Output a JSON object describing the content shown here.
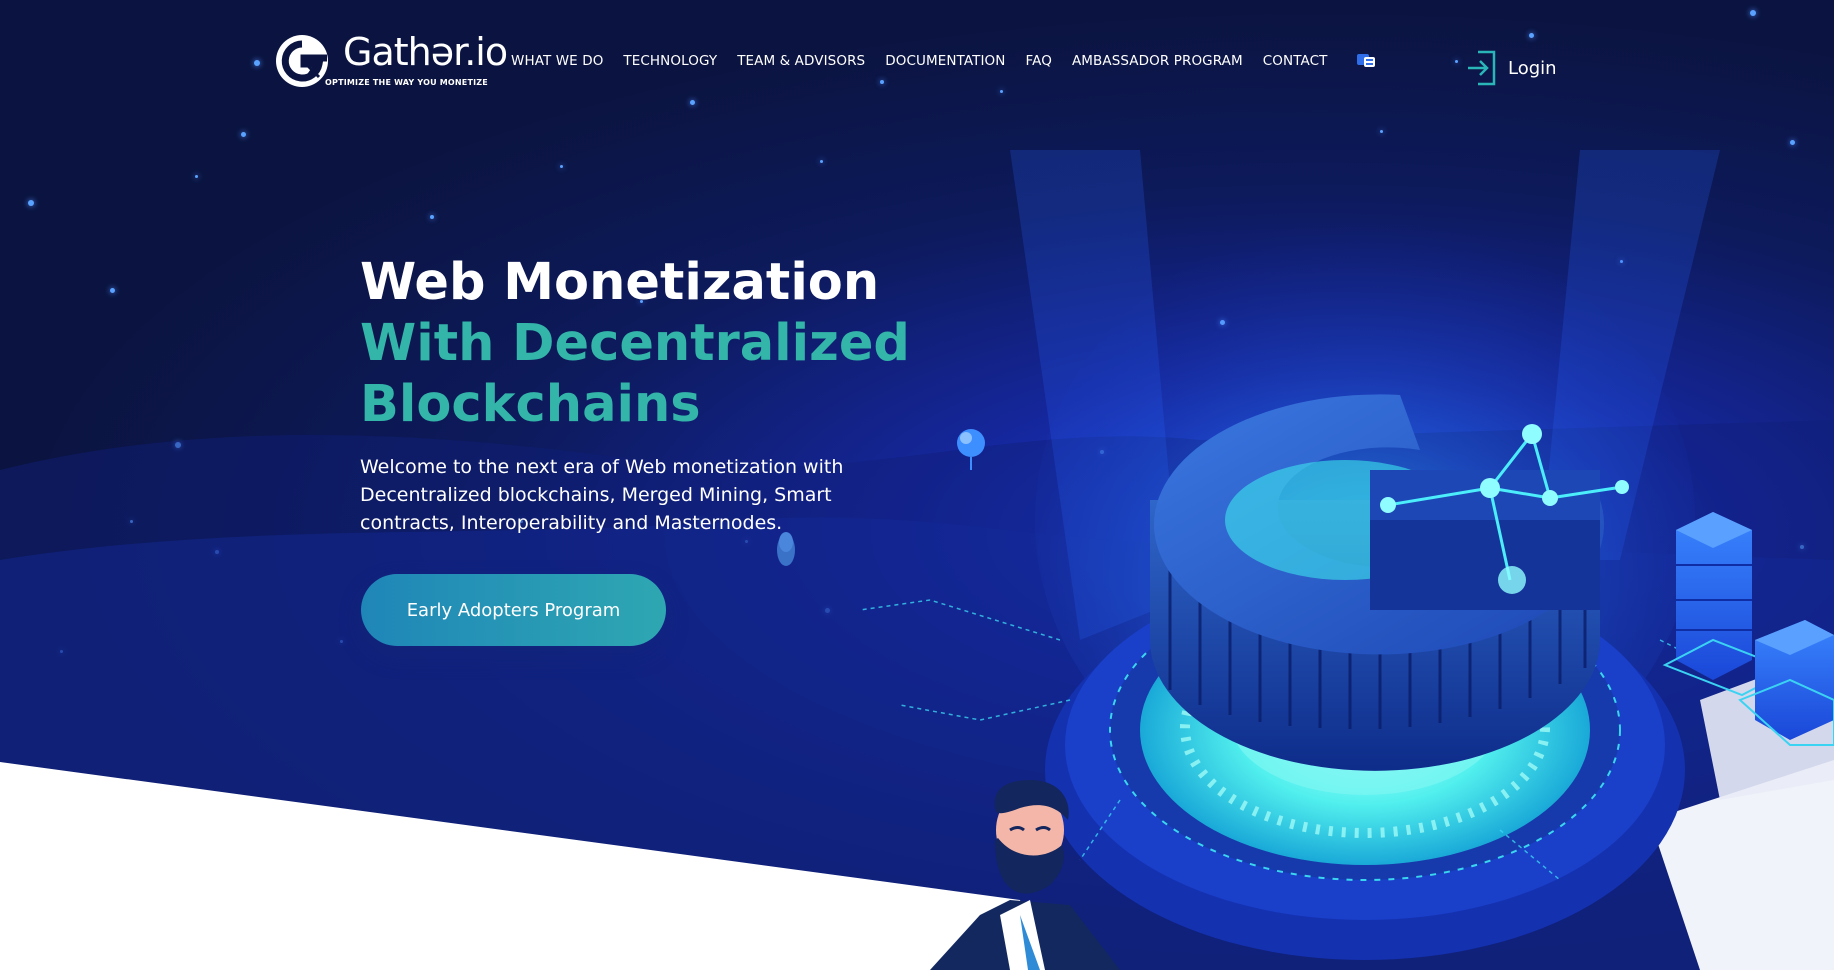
{
  "brand": {
    "name": "Gathər.io",
    "tagline": "OPTIMIZE THE WAY YOU MONETIZE"
  },
  "nav": {
    "items": [
      {
        "label": "WHAT WE DO"
      },
      {
        "label": "TECHNOLOGY"
      },
      {
        "label": "TEAM & ADVISORS"
      },
      {
        "label": "DOCUMENTATION"
      },
      {
        "label": "FAQ"
      },
      {
        "label": "AMBASSADOR PROGRAM"
      },
      {
        "label": "CONTACT"
      }
    ],
    "login_label": "Login"
  },
  "hero": {
    "headline_line1": "Web Monetization",
    "headline_line2": "With Decentralized",
    "headline_line3": "Blockchains",
    "subtext": "Welcome to the next era of Web monetization with Decentralized blockchains, Merged Mining, Smart contracts, Interoperability and Masternodes.",
    "cta_label": "Early Adopters Program"
  },
  "colors": {
    "background": "#0b1440",
    "accent_teal": "#33b5a9",
    "button_start": "#1f86b8",
    "button_end": "#2ea7b2",
    "glow": "#3ef0f0"
  },
  "icons": {
    "logo": "gather-g-logo",
    "language": "flag-icon",
    "login": "login-arrow-icon"
  }
}
